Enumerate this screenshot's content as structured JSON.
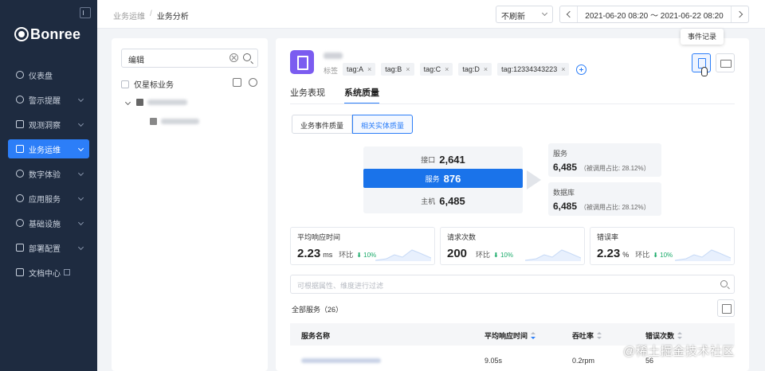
{
  "brand": {
    "name": "Bonree"
  },
  "sidebar": {
    "items": [
      {
        "label": "仪表盘",
        "icon": "dashboard-icon",
        "has_children": false
      },
      {
        "label": "警示提醒",
        "icon": "alert-icon",
        "has_children": true
      },
      {
        "label": "观测洞察",
        "icon": "insight-icon",
        "has_children": true
      },
      {
        "label": "业务运维",
        "icon": "business-ops-icon",
        "has_children": true,
        "active": true
      },
      {
        "label": "数字体验",
        "icon": "user-experience-icon",
        "has_children": true
      },
      {
        "label": "应用服务",
        "icon": "app-service-icon",
        "has_children": true
      },
      {
        "label": "基础设施",
        "icon": "infrastructure-icon",
        "has_children": true
      },
      {
        "label": "部署配置",
        "icon": "deploy-config-icon",
        "has_children": true
      },
      {
        "label": "文档中心",
        "icon": "docs-icon",
        "has_children": false,
        "external": true
      }
    ]
  },
  "header": {
    "breadcrumb": [
      "业务运维",
      "业务分析"
    ],
    "refresh": {
      "selected": "不刷新"
    },
    "time_range": "2021-06-20 08:20 ～ 2021-06-22 08:20"
  },
  "left_panel": {
    "search": {
      "value": "编辑"
    },
    "only_star_label": "仅星标业务"
  },
  "service": {
    "tags_label": "标签",
    "tags": [
      "tag:A",
      "tag:B",
      "tag:C",
      "tag:D",
      "tag:12334343223"
    ],
    "tag_remove": "×",
    "event_tooltip": "事件记录"
  },
  "tabs": [
    {
      "label": "业务表现",
      "active": false
    },
    {
      "label": "系统质量",
      "active": true
    }
  ],
  "quality_toggle": [
    {
      "label": "业务事件质量",
      "active": false
    },
    {
      "label": "相关实体质量",
      "active": true
    }
  ],
  "topology": {
    "entities": [
      {
        "label": "接口",
        "value": "2,641",
        "selected": false
      },
      {
        "label": "服务",
        "value": "876",
        "selected": true
      },
      {
        "label": "主机",
        "value": "6,485",
        "selected": false
      }
    ],
    "dependencies": [
      {
        "label": "服务",
        "value": "6,485",
        "ratio": "（被调用占比: 28.12%）"
      },
      {
        "label": "数据库",
        "value": "6,485",
        "ratio": "（被调用占比: 28.12%）"
      }
    ]
  },
  "metrics": [
    {
      "title": "平均响应时间",
      "value": "2.23",
      "unit": "ms",
      "compare_label": "环比",
      "delta": "⬇ 10%"
    },
    {
      "title": "请求次数",
      "value": "200",
      "unit": "",
      "compare_label": "环比",
      "delta": "⬇ 10%"
    },
    {
      "title": "错误率",
      "value": "2.23",
      "unit": "%",
      "compare_label": "环比",
      "delta": "⬇ 10%"
    }
  ],
  "filter": {
    "placeholder": "可根据属性、维度进行过滤"
  },
  "services_table": {
    "title": "全部服务（26）",
    "columns": [
      "服务名称",
      "平均响应时间",
      "吞吐率",
      "错误次数"
    ],
    "rows": [
      {
        "avg_response": "9.05s",
        "throughput": "0.2rpm",
        "errors": "56"
      }
    ]
  },
  "watermark": "@稀土掘金技术社区",
  "colors": {
    "sidebar_bg": "#1e2b40",
    "accent": "#2c7ef8",
    "positive": "#1aab6a",
    "avatar": "#7b5cf0"
  }
}
